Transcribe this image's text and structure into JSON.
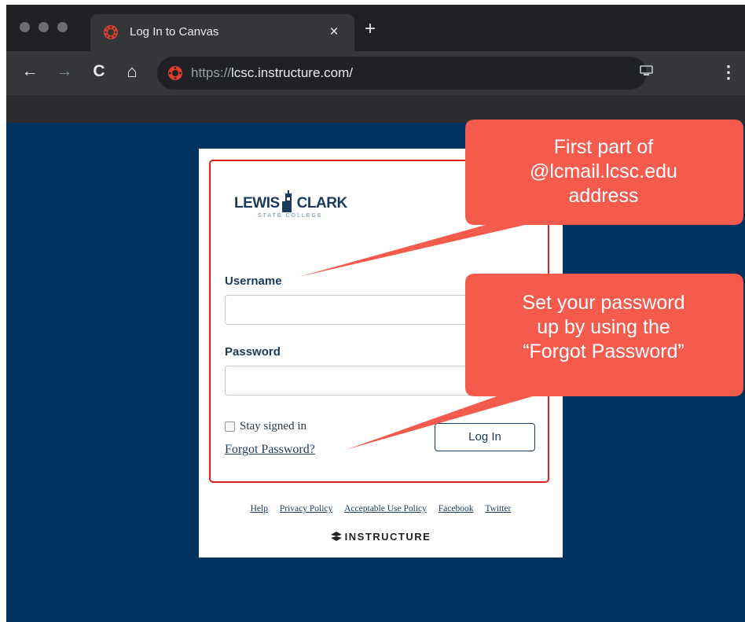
{
  "browser": {
    "tab_title": "Log In to Canvas",
    "url_scheme": "https://",
    "url_host": "lcsc.instructure.com/",
    "tab_close_glyph": "×",
    "new_tab_glyph": "+",
    "back_glyph": "←",
    "forward_glyph": "→",
    "reload_glyph": "C",
    "home_glyph": "⌂",
    "menu_glyph": "⋮",
    "icons": [
      "canvas-logo-icon",
      "back-arrow-icon",
      "forward-arrow-icon",
      "reload-icon",
      "home-icon",
      "cast-icon",
      "menu-icon"
    ]
  },
  "login": {
    "logo_text_left": "LEWIS",
    "logo_text_right": "CLARK",
    "logo_sub": "STATE COLLEGE",
    "username_label": "Username",
    "password_label": "Password",
    "stay_signed_in": "Stay signed in",
    "forgot_password": "Forgot Password?",
    "login_button": "Log In"
  },
  "footer": {
    "links": [
      "Help",
      "Privacy Policy",
      "Acceptable Use Policy",
      "Facebook",
      "Twitter"
    ],
    "brand": "INSTRUCTURE"
  },
  "callouts": {
    "username_note": [
      "First part of",
      "@lcmail.lcsc.edu",
      "address"
    ],
    "password_note": [
      "Set your password",
      "up by using the",
      "“Forgot Password”"
    ]
  },
  "colors": {
    "page_background": "#00335f",
    "callout": "#f45b4d",
    "highlight_border": "#e02020",
    "brand_navy": "#1b3a5c"
  }
}
